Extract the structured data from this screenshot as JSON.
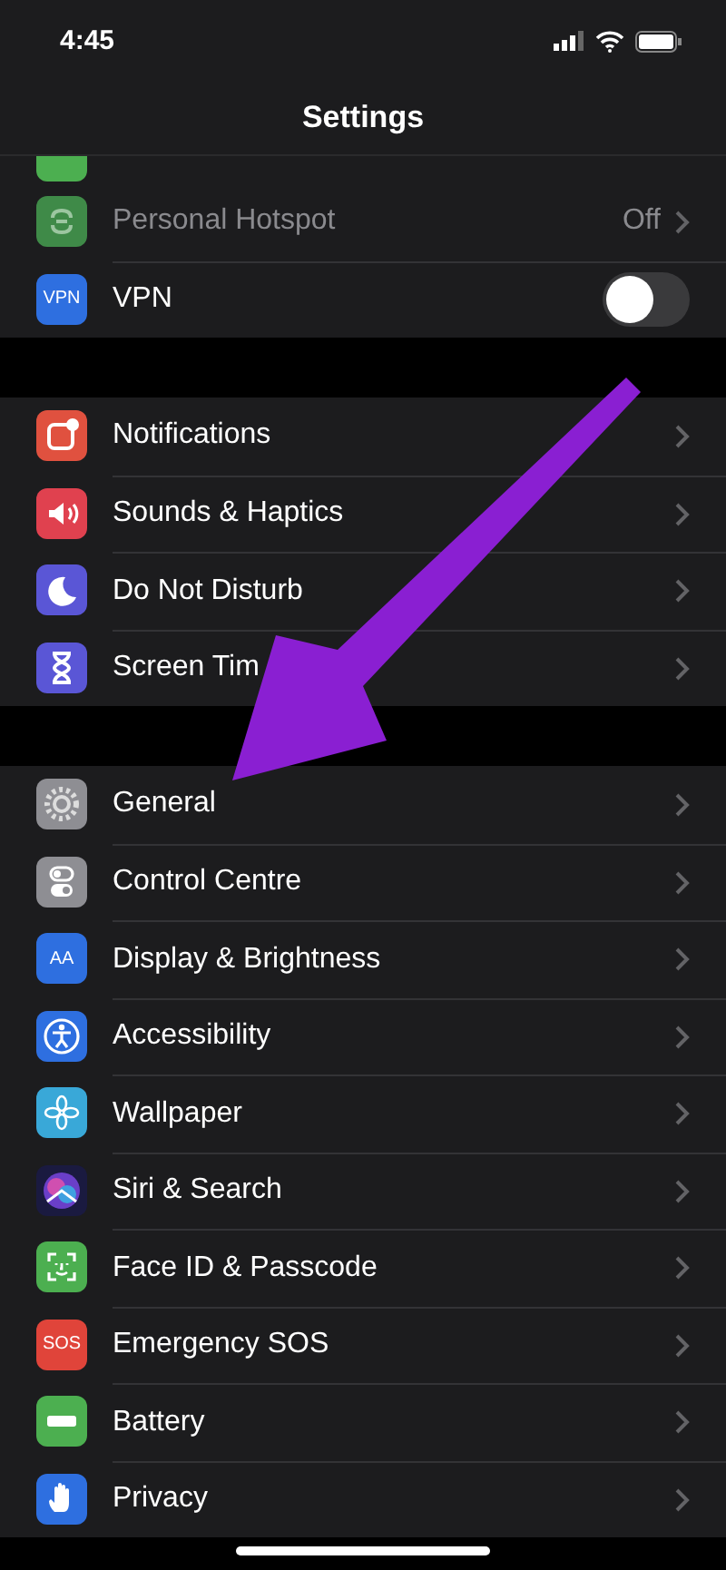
{
  "status_bar": {
    "time": "4:45"
  },
  "nav": {
    "title": "Settings"
  },
  "groups": [
    {
      "rows": [
        {
          "kind": "link",
          "label": "Personal Hotspot",
          "value": "Off",
          "disabled": true
        },
        {
          "kind": "toggle",
          "label": "VPN",
          "icon_text": "VPN",
          "on": false
        }
      ]
    },
    {
      "rows": [
        {
          "kind": "link",
          "label": "Notifications"
        },
        {
          "kind": "link",
          "label": "Sounds & Haptics"
        },
        {
          "kind": "link",
          "label": "Do Not Disturb"
        },
        {
          "kind": "link",
          "label": "Screen Tim"
        }
      ]
    },
    {
      "rows": [
        {
          "kind": "link",
          "label": "General"
        },
        {
          "kind": "link",
          "label": "Control Centre"
        },
        {
          "kind": "link",
          "label": "Display & Brightness",
          "icon_text": "AA"
        },
        {
          "kind": "link",
          "label": "Accessibility"
        },
        {
          "kind": "link",
          "label": "Wallpaper"
        },
        {
          "kind": "link",
          "label": "Siri & Search"
        },
        {
          "kind": "link",
          "label": "Face ID & Passcode"
        },
        {
          "kind": "link",
          "label": "Emergency SOS",
          "icon_text": "SOS"
        },
        {
          "kind": "link",
          "label": "Battery"
        },
        {
          "kind": "link",
          "label": "Privacy"
        }
      ]
    }
  ]
}
